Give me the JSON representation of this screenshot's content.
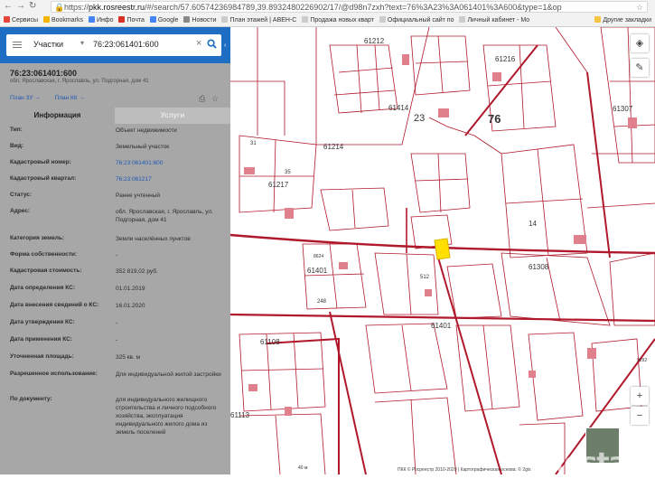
{
  "browser": {
    "url_host": "pkk.rosreestr.ru",
    "url_rest": "/#/search/57.605742369847​89,39.8932480226902/17/@d98n7zxh?text=76%3A23%3A061401%3A600&type=1&op",
    "bookmarks": [
      {
        "label": "Сервисы",
        "color": "#e6453a"
      },
      {
        "label": "Bookmarks",
        "color": "#f4b400"
      },
      {
        "label": "Инфо",
        "color": "#4285f4"
      },
      {
        "label": "Почта",
        "color": "#d93025"
      },
      {
        "label": "Google",
        "color": "#4285f4"
      },
      {
        "label": "Новости",
        "color": "#888888"
      },
      {
        "label": "План этажей | АВЕН-С",
        "color": "#cccccc"
      },
      {
        "label": "Продажа новых кварт",
        "color": "#cccccc"
      },
      {
        "label": "Официальный сайт по",
        "color": "#cccccc"
      },
      {
        "label": "Личный кабинет - Мо",
        "color": "#cccccc"
      }
    ],
    "other_bookmarks": "Другие закладки"
  },
  "search": {
    "select_value": "Участки",
    "query": "76:23:061401:600"
  },
  "parcel": {
    "cadastral_number": "76:23:061401:600",
    "short_address": "обл. Ярославская, г. Ярославль, ул. Подгорная, дом 41",
    "link_zu": "План ЗУ →",
    "link_kk": "План КК →",
    "tab_info": "Информация",
    "tab_services": "Услуги",
    "rows": [
      {
        "label": "Тип:",
        "value": "Объект недвижимости",
        "link": false
      },
      {
        "label": "Вид:",
        "value": "Земельный участок",
        "link": false
      },
      {
        "label": "Кадастровый номер:",
        "value": "76:23:061401:600",
        "link": true
      },
      {
        "label": "Кадастровый квартал:",
        "value": "76:23:061217",
        "link": true
      },
      {
        "label": "Статус:",
        "value": "Ранее учтенный",
        "link": false
      },
      {
        "label": "Адрес:",
        "value": "обл. Ярославская, г. Ярославль, ул. Подгорная, дом 41",
        "link": false
      },
      {
        "label": "Категория земель:",
        "value": "Земли населённых пунктов",
        "link": false
      },
      {
        "label": "Форма собственности:",
        "value": "-",
        "link": false
      },
      {
        "label": "Кадастровая стоимость:",
        "value": "352 819,02 руб.",
        "link": false
      },
      {
        "label": "Дата определения КС:",
        "value": "01.01.2019",
        "link": false
      },
      {
        "label": "Дата внесения сведений о КС:",
        "value": "16.01.2020",
        "link": false
      },
      {
        "label": "Дата утверждения КС:",
        "value": "-",
        "link": false
      },
      {
        "label": "Дата применения КС:",
        "value": "-",
        "link": false
      },
      {
        "label": "Уточненная площадь:",
        "value": "325 кв. м",
        "link": false
      },
      {
        "label": "Разрешенное использование:",
        "value": "Для индивидуальной жилой застройки",
        "link": false
      },
      {
        "label": "По документу:",
        "value": "для индивидуального жилищного строительства и личного подсобного хозяйства, эксплуатация индивидуального жилого дома из земель поселений",
        "link": false
      }
    ]
  },
  "map": {
    "labels": [
      {
        "text": "61212"
      },
      {
        "text": "61216"
      },
      {
        "text": "61414"
      },
      {
        "text": "23"
      },
      {
        "text": "76"
      },
      {
        "text": "61307"
      },
      {
        "text": "61214"
      },
      {
        "text": "61217"
      },
      {
        "text": "61401"
      },
      {
        "text": "61308"
      },
      {
        "text": "61401"
      },
      {
        "text": "61108"
      },
      {
        "text": "61113"
      },
      {
        "text": "14"
      },
      {
        "text": "512"
      },
      {
        "text": "31"
      },
      {
        "text": "35"
      },
      {
        "text": "248"
      },
      {
        "text": "8624"
      },
      {
        "text": "9292"
      }
    ],
    "attribution": "ПКК © Росреестр 2010-2020 | Картографическая основа: © 2gis",
    "scale": "40 м",
    "watermark": "Restate",
    "zoom_in": "+",
    "zoom_out": "−",
    "selected_color": "#ffe000",
    "line_color": "#b0182b"
  }
}
